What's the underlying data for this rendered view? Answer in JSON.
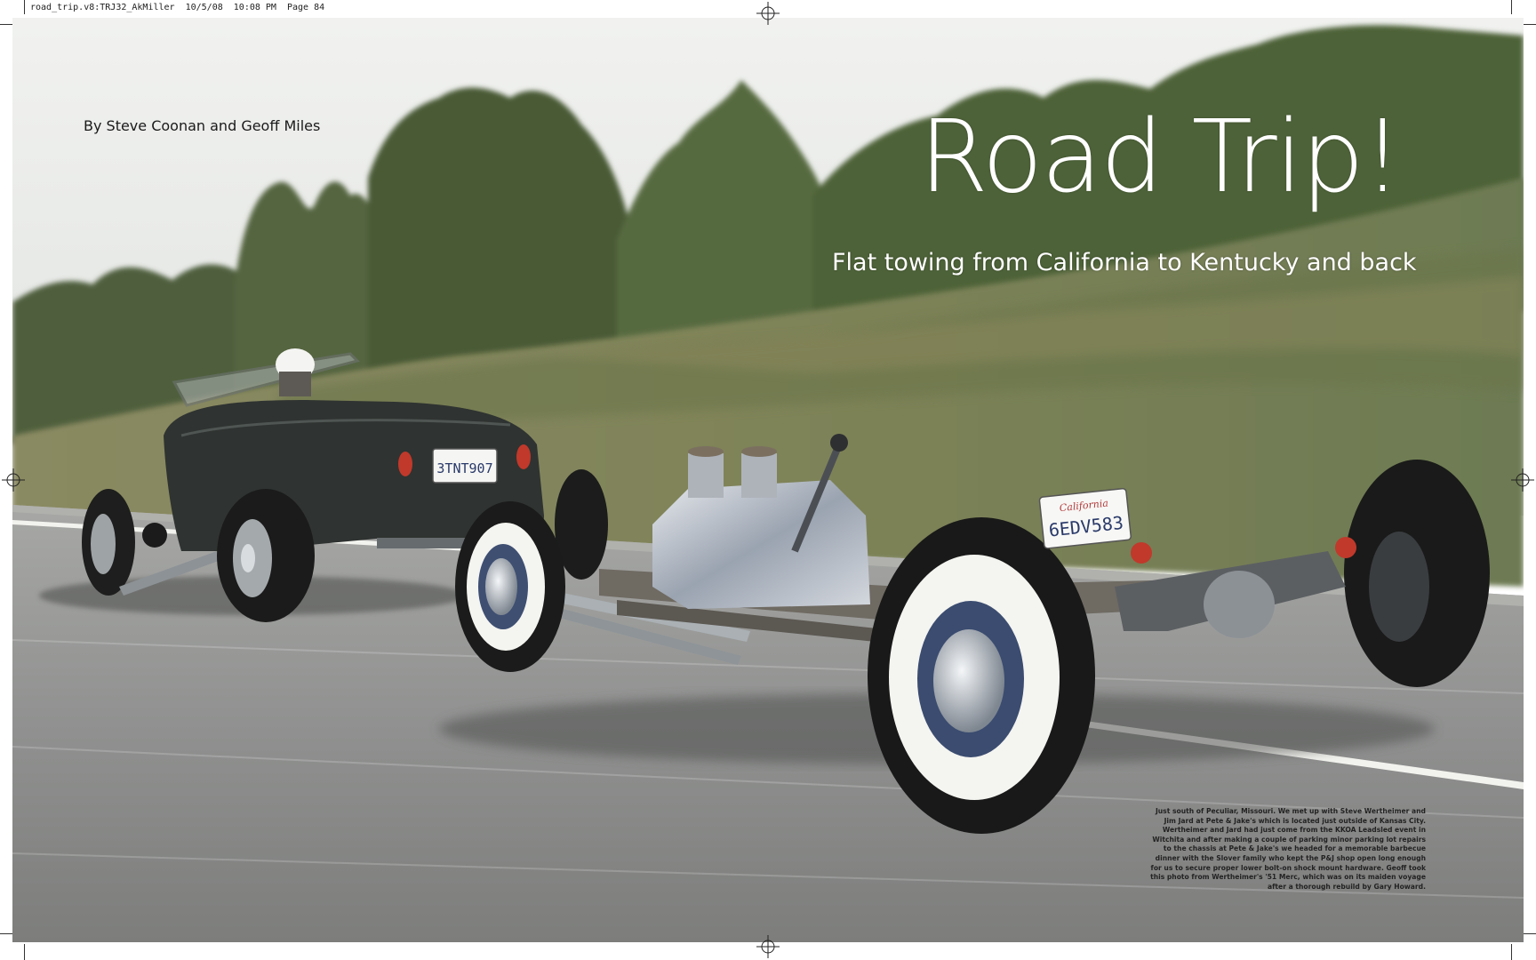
{
  "slug": "road_trip.v8:TRJ32_AkMiller  10/5/08  10:08 PM  Page 84",
  "byline": "By Steve Coonan and Geoff Miles",
  "title": "Road Trip!",
  "subtitle": "Flat towing from California to Kentucky and back",
  "caption": "Just south of Peculiar, Missouri. We met up with Steve Wertheimer and Jim Jard at Pete & Jake's which is located just outside of Kansas City. Wertheimer and Jard  had just come from the KKOA Leadsled event in Witchita and after making a couple of parking minor parking lot repairs to the chassis at Pete & Jake's we headed for a memorable barbecue dinner with the Slover family who kept the P&J shop open long enough for us to secure proper lower bolt-on shock mount hardware. Geoff took this photo from Wertheimer's '51 Merc, which was on its maiden voyage after a thorough rebuild by Gary Howard.",
  "plates": {
    "roadster": "3TNT907",
    "chassis_state": "California",
    "chassis": "6EDV583"
  },
  "colors": {
    "sky": "#e9ebea",
    "foliage": "#5f7048",
    "road": "#8e8f8d",
    "roadster_body": "#2e3230",
    "whitewall": "#f4f4f0",
    "tail_light": "#c0392b"
  },
  "icons": [
    "registration-mark-icon",
    "crop-mark-icon"
  ]
}
